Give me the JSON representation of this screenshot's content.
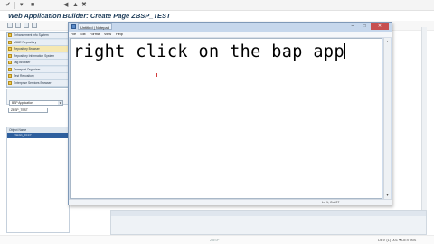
{
  "sap": {
    "title": "Web Application Builder: Create Page ZBSP_TEST",
    "nav_items": [
      {
        "label": "Enhancement Info System"
      },
      {
        "label": "MIME Repository"
      },
      {
        "label": "Repository Browser"
      },
      {
        "label": "Repository Information System"
      },
      {
        "label": "Tag Browser"
      },
      {
        "label": "Transport Organizer"
      },
      {
        "label": "Test Repository"
      },
      {
        "label": "Enterprise Services Browser"
      }
    ],
    "object_type": "BSP Application",
    "object_name": "ZBSP_TEST",
    "tree_header": "Object Name",
    "tree_item": "ZBSP_TEST",
    "status_center": "ZBSP",
    "status_right": "DEV (1) 001 ▾ DEV INS"
  },
  "notepad": {
    "title": "Untitled - Notepad",
    "tab_label": "Untitled | Notepad",
    "menus": [
      "File",
      "Edit",
      "Format",
      "View",
      "Help"
    ],
    "text": "right click on the bap app",
    "status": "Ln 1, Col 27"
  },
  "icons": {
    "notepad": "notepad-icon",
    "minimize": "minimize-icon",
    "maximize": "maximize-icon",
    "close": "close-icon"
  },
  "colors": {
    "sap_title": "#1b3a57",
    "nav_panel": "#dbe5ef",
    "tree_selected": "#2e5f9e",
    "close_button": "#c75050",
    "cursor": "#d23b3b"
  }
}
